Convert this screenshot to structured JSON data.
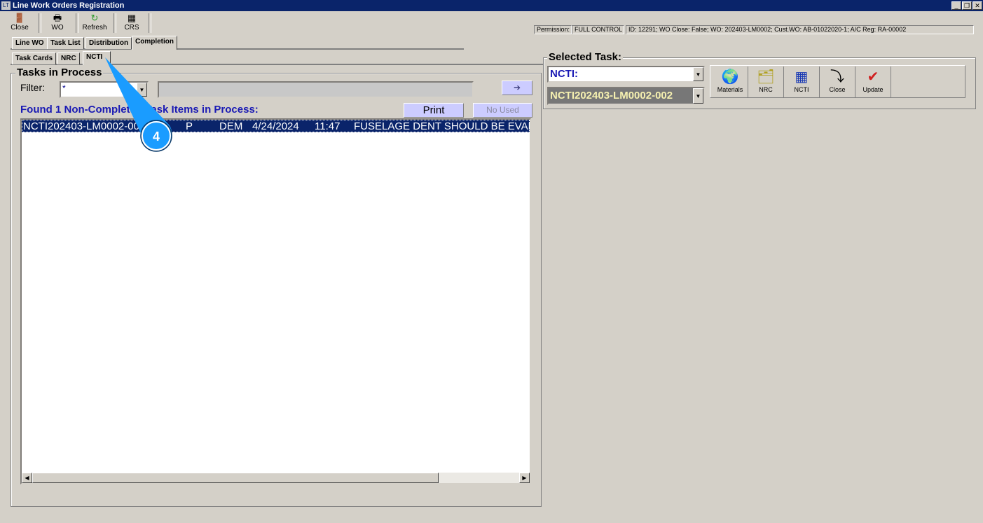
{
  "window": {
    "title": "Line Work Orders Registration"
  },
  "toolbar": [
    {
      "label": "Close",
      "icon": "door-exit-icon"
    },
    {
      "label": "WO",
      "icon": "printer-icon"
    },
    {
      "label": "Refresh",
      "icon": "refresh-icon"
    },
    {
      "label": "CRS",
      "icon": "crs-icon"
    }
  ],
  "status": {
    "perm_label": "Permission:",
    "perm_value": "FULL CONTROL",
    "info": "ID: 12291; WO Close: False; WO: 202403-LM0002; Cust.WO: AB-01022020-1; A/C Reg: RA-00002"
  },
  "tabs": [
    "Line WO",
    "Task List",
    "Distribution",
    "Completion"
  ],
  "subtabs": [
    "Task Cards",
    "NRC",
    "NCTI"
  ],
  "left": {
    "title": "Tasks in Process",
    "filter_label": "Filter:",
    "filter_value": "*",
    "found": "Found 1 Non-Completed Task Items in Process:",
    "print": "Print",
    "no_used": "No Used",
    "go": "➔",
    "rows": [
      {
        "id": "NCTI202403-LM0002-002",
        "status": "P",
        "by": "DEM",
        "date": "4/24/2024",
        "time": "11:47",
        "desc": "FUSELAGE DENT SHOULD BE EVALUATED"
      }
    ]
  },
  "right": {
    "title": "Selected Task:",
    "type_value": "NCTI:",
    "task_value": "NCTI202403-LM0002-002",
    "buttons": [
      {
        "label": "Materials",
        "icon": "materials-icon"
      },
      {
        "label": "NRC",
        "icon": "nrc-icon"
      },
      {
        "label": "NCTI",
        "icon": "ncti-icon"
      },
      {
        "label": "Close",
        "icon": "close-task-icon"
      },
      {
        "label": "Update",
        "icon": "update-icon"
      }
    ]
  },
  "callout": {
    "number": "4",
    "color": "#1a9cff"
  }
}
